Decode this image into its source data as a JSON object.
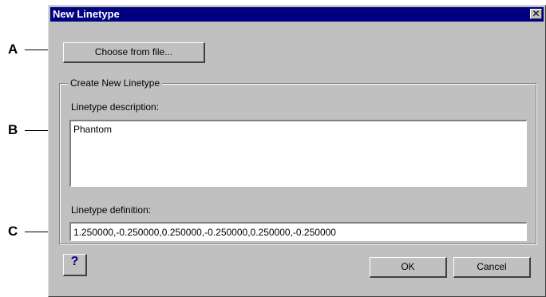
{
  "callouts": [
    "A",
    "B",
    "C"
  ],
  "dialog": {
    "title": "New Linetype",
    "close_glyph": "✕"
  },
  "buttons": {
    "choose_from_file": "Choose from file...",
    "help": "?",
    "ok": "OK",
    "cancel": "Cancel"
  },
  "group": {
    "legend": "Create New Linetype",
    "description_label": "Linetype description:",
    "description_value": "Phantom",
    "definition_label": "Linetype definition:",
    "definition_value": "1.250000,-0.250000,0.250000,-0.250000,0.250000,-0.250000"
  },
  "colors": {
    "title_bar": "#000080",
    "dialog_face": "#c0c0c0"
  }
}
